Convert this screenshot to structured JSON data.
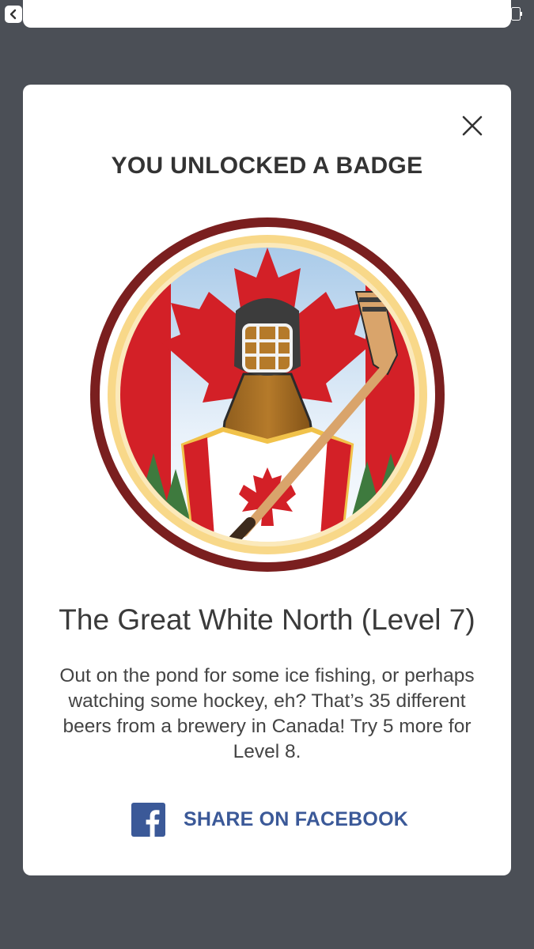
{
  "modal": {
    "title": "YOU UNLOCKED A BADGE",
    "badge_name": "The Great White North (Level 7)",
    "badge_description": "Out on the pond for some ice fishing, or perhaps watching some hockey, eh? That’s 35 different beers from a brewery in Canada! Try 5 more for Level 8.",
    "share_label": "SHARE ON FACEBOOK"
  },
  "icons": {
    "back": "chevron-left-icon",
    "battery": "battery-icon",
    "close": "close-icon",
    "badge": "badge-image",
    "share": "facebook-icon"
  },
  "colors": {
    "backdrop": "#4b4f56",
    "facebook_blue": "#3b5998",
    "canada_red": "#d32027",
    "badge_ring": "#7a1f1f"
  }
}
